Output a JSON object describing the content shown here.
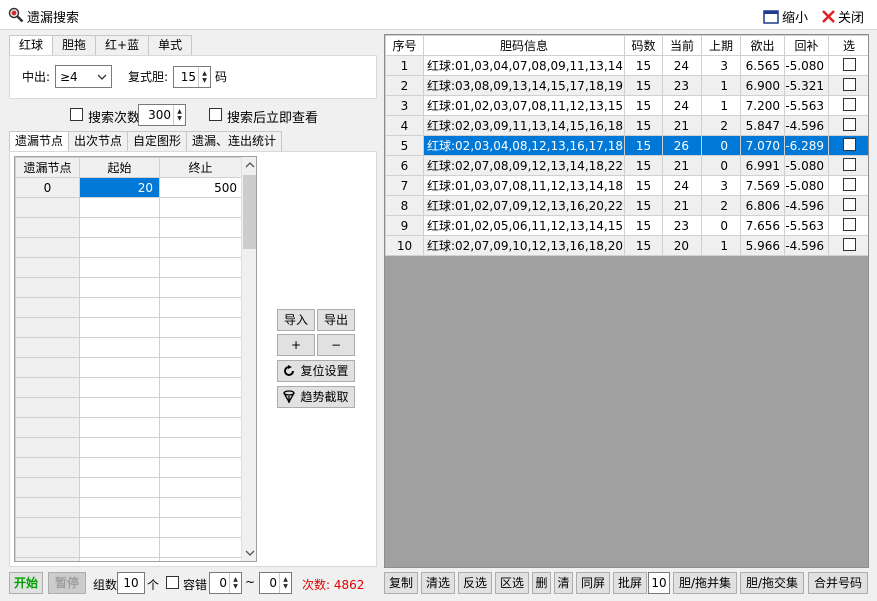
{
  "window": {
    "title": "遗漏搜索",
    "shrink_label": "缩小",
    "close_label": "关闭"
  },
  "top_tabs": [
    {
      "label": "红球"
    },
    {
      "label": "胆拖"
    },
    {
      "label": "红+蓝"
    },
    {
      "label": "单式"
    }
  ],
  "controls": {
    "zhongchu_label": "中出:",
    "zhongchu_value": "≥4",
    "fushidan_label": "复式胆:",
    "fushidan_value": "15",
    "ma_label": "码",
    "search_count_label": "搜索次数",
    "search_count_value": "300",
    "search_then_view_label": "搜索后立即查看"
  },
  "sub_tabs": [
    {
      "label": "遗漏节点"
    },
    {
      "label": "出次节点"
    },
    {
      "label": "自定图形"
    },
    {
      "label": "遗漏、连出统计"
    }
  ],
  "node_table": {
    "headers": [
      "遗漏节点",
      "起始",
      "终止"
    ],
    "rows": [
      {
        "node": "0",
        "start": "20",
        "end": "500"
      }
    ]
  },
  "side_buttons": {
    "import": "导入",
    "export": "导出",
    "plus": "+",
    "minus": "−",
    "reset": "复位设置",
    "trend": "趋势截取"
  },
  "bottom_left": {
    "start": "开始",
    "pause": "暂停",
    "group_label": "组数",
    "group_value": "10",
    "ge_label": "个",
    "tolerance_label": "容错",
    "tol_from": "0",
    "tilde": "~",
    "tol_to": "0",
    "count_text": "次数: 4862"
  },
  "result_table": {
    "headers": [
      "序号",
      "胆码信息",
      "码数",
      "当前",
      "上期",
      "欲出",
      "回补",
      "选"
    ],
    "rows": [
      {
        "idx": "1",
        "info": "红球:01,03,04,07,08,09,11,13,14,......",
        "count": "15",
        "cur": "24",
        "prev": "3",
        "out": "6.565",
        "back": "-5.080"
      },
      {
        "idx": "2",
        "info": "红球:03,08,09,13,14,15,17,18,19,......",
        "count": "15",
        "cur": "23",
        "prev": "1",
        "out": "6.900",
        "back": "-5.321"
      },
      {
        "idx": "3",
        "info": "红球:01,02,03,07,08,11,12,13,15,......",
        "count": "15",
        "cur": "24",
        "prev": "1",
        "out": "7.200",
        "back": "-5.563"
      },
      {
        "idx": "4",
        "info": "红球:02,03,09,11,13,14,15,16,18,......",
        "count": "15",
        "cur": "21",
        "prev": "2",
        "out": "5.847",
        "back": "-4.596"
      },
      {
        "idx": "5",
        "info": "红球:02,03,04,08,12,13,16,17,18,......",
        "count": "15",
        "cur": "26",
        "prev": "0",
        "out": "7.070",
        "back": "-6.289"
      },
      {
        "idx": "6",
        "info": "红球:02,07,08,09,12,13,14,18,22,......",
        "count": "15",
        "cur": "21",
        "prev": "0",
        "out": "6.991",
        "back": "-5.080"
      },
      {
        "idx": "7",
        "info": "红球:01,03,07,08,11,12,13,14,18,......",
        "count": "15",
        "cur": "24",
        "prev": "3",
        "out": "7.569",
        "back": "-5.080"
      },
      {
        "idx": "8",
        "info": "红球:01,02,07,09,12,13,16,20,22,......",
        "count": "15",
        "cur": "21",
        "prev": "2",
        "out": "6.806",
        "back": "-4.596"
      },
      {
        "idx": "9",
        "info": "红球:01,02,05,06,11,12,13,14,15,......",
        "count": "15",
        "cur": "23",
        "prev": "0",
        "out": "7.656",
        "back": "-5.563"
      },
      {
        "idx": "10",
        "info": "红球:02,07,09,10,12,13,16,18,20,......",
        "count": "15",
        "cur": "20",
        "prev": "1",
        "out": "5.966",
        "back": "-4.596"
      }
    ]
  },
  "bottom_right": {
    "copy": "复制",
    "clear_sel": "清选",
    "invert": "反选",
    "range_sel": "区选",
    "delete": "删",
    "clear": "清",
    "same_screen": "同屏",
    "batch_screen": "批屏",
    "batch_value": "10",
    "union": "胆/拖并集",
    "intersect": "胆/拖交集",
    "merge": "合并号码"
  },
  "colors": {
    "selection": "#0078d7",
    "count_text": "#e00000",
    "start_text": "#00a000",
    "grid_gray": "#a0a0a0"
  }
}
